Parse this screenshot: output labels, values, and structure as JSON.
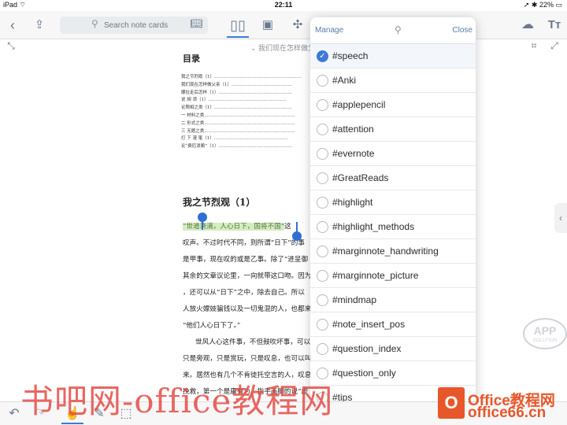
{
  "status": {
    "device": "iPad",
    "time": "22:11",
    "battery": "22%"
  },
  "toolbar": {
    "search_placeholder": "Search note cards",
    "icons": [
      "back-chevron-icon",
      "share-icon",
      "search-icon",
      "book-icon",
      "mindmap-icon",
      "cloud-sync-icon",
      "text-size-icon"
    ]
  },
  "subbar": {
    "crumb": "我们现在怎样做父"
  },
  "page": {
    "toc_title": "目录",
    "toc": [
      "我之节烈观（1）……………………………………………………",
      "我们现在怎样做父亲（1）……………………………………",
      "娜拉走后怎样（1）……………………………………………",
      "说  胡  须（1）………………………………………………",
      "论照相之类（1）………………………………………………",
      "一  材料之类………………………………………………………",
      "二  形式之类………………………………………………………",
      "三  无题之类………………………………………………………",
      "灯  下  漫  笔（1）……………………………………………",
      "论“费厄泼赖”（1）……………………………………………"
    ],
    "chapter_title": "我之节烈观（1）",
    "highlight": "“世道浇漓，人心日下，国将不国”",
    "highlight_suffix": "这",
    "lines": [
      "叹声。不过时代不同，则所谓“日下”的事",
      "是甲事，现在叹的或是乙事。除了“进呈御",
      "其余的文章议论里，一向就带这口吻。因为",
      "，还可以从“日下”之中，除去自己。所以",
      "人放火嫖妓骗钱以及一切鬼混的人，也都来",
      "“他们人心日下了。”",
      "世风人心这件事，不但鼓吹坏事，可以",
      "只是旁观，只是赏玩，只是叹息，也可以叫",
      "来。居然也有几个不肯徒托空言的人，叹息",
      "挽救，第一个是康有为，指手画脚的说“虚"
    ]
  },
  "panel": {
    "manage_label": "Manage",
    "close_label": "Close",
    "tags": [
      {
        "label": "#speech",
        "checked": true
      },
      {
        "label": "#Anki",
        "checked": false
      },
      {
        "label": "#applepencil",
        "checked": false
      },
      {
        "label": "#attention",
        "checked": false
      },
      {
        "label": "#evernote",
        "checked": false
      },
      {
        "label": "#GreatReads",
        "checked": false
      },
      {
        "label": "#highlight",
        "checked": false
      },
      {
        "label": "#highlight_methods",
        "checked": false
      },
      {
        "label": "#marginnote_handwriting",
        "checked": false
      },
      {
        "label": "#marginnote_picture",
        "checked": false
      },
      {
        "label": "#mindmap",
        "checked": false
      },
      {
        "label": "#note_insert_pos",
        "checked": false
      },
      {
        "label": "#question_index",
        "checked": false
      },
      {
        "label": "#question_only",
        "checked": false
      },
      {
        "label": "#tips",
        "checked": false
      }
    ]
  },
  "watermarks": {
    "app_top": "APP",
    "app_bottom": "SOLUTION",
    "site_cn": "书吧网-office教程网",
    "office_line1": "Office教程网",
    "office_line2": "office66.cn"
  },
  "colors": {
    "accent": "#3d7ad6",
    "highlight": "#d5ecc2",
    "watermark": "#e64c46",
    "office": "#e8572a"
  }
}
